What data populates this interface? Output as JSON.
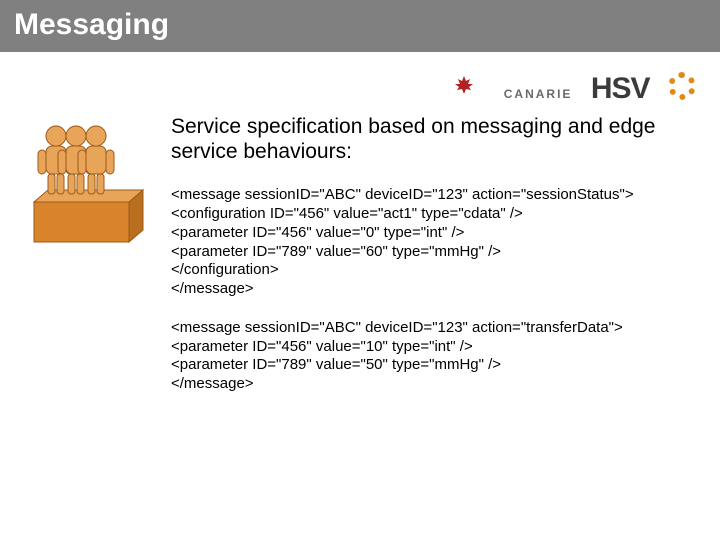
{
  "title": "Messaging",
  "logos": {
    "canarie": "CANARIE",
    "hsv": "HSV"
  },
  "intro": "Service specification based on messaging and edge service behaviours:",
  "code1": "<message sessionID=\"ABC\" deviceID=\"123\" action=\"sessionStatus\">\n<configuration ID=\"456\" value=\"act1\" type=\"cdata\" />\n<parameter ID=\"456\" value=\"0\" type=\"int\" />\n<parameter ID=\"789\" value=\"60\" type=\"mmHg\" />\n</configuration>\n</message>",
  "code2": "<message sessionID=\"ABC\" deviceID=\"123\" action=\"transferData\">\n<parameter ID=\"456\" value=\"10\" type=\"int\" />\n<parameter ID=\"789\" value=\"50\" type=\"mmHg\" />\n</message>"
}
